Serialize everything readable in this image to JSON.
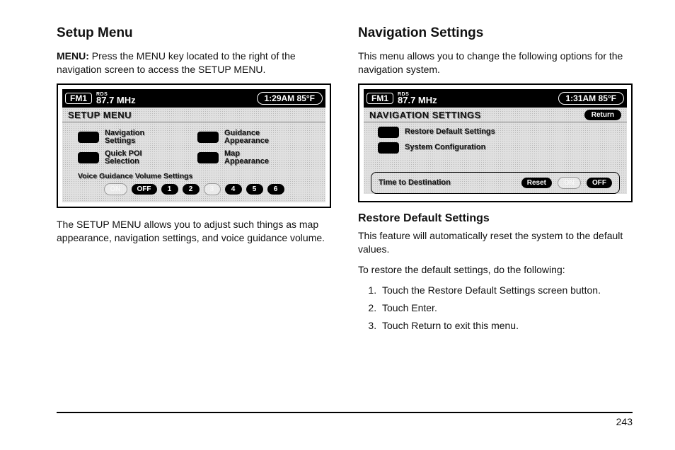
{
  "left": {
    "heading": "Setup Menu",
    "intro_label": "MENU:",
    "intro_text": "  Press the MENU key located to the right of the navigation screen to access the SETUP MENU.",
    "after_text": "The SETUP MENU allows you to adjust such things as map appearance, navigation settings, and voice guidance volume.",
    "screen": {
      "band": "FM1",
      "rds": "RDS",
      "freq": "87.7 MHz",
      "clock": "1:29AM 85°F",
      "title": "SETUP MENU",
      "items": [
        {
          "label": "Navigation\nSettings"
        },
        {
          "label": "Guidance\nAppearance"
        },
        {
          "label": "Quick POI\nSelection"
        },
        {
          "label": "Map\nAppearance"
        }
      ],
      "vol_caption": "Voice Guidance Volume Settings",
      "vol_buttons": [
        "ON",
        "OFF",
        "1",
        "2",
        "3",
        "4",
        "5",
        "6"
      ]
    }
  },
  "right": {
    "heading": "Navigation Settings",
    "intro_text": "This menu allows you to change the following options for the navigation system.",
    "screen": {
      "band": "FM1",
      "rds": "RDS",
      "freq": "87.7 MHz",
      "clock": "1:31AM 85°F",
      "title": "NAVIGATION SETTINGS",
      "return": "Return",
      "items": [
        {
          "label": "Restore Default Settings"
        },
        {
          "label": "System Configuration"
        }
      ],
      "ttd_label": "Time to Destination",
      "ttd_buttons": [
        "Reset",
        "ON",
        "OFF"
      ]
    },
    "sub_heading": "Restore Default Settings",
    "sub_p1": "This feature will automatically reset the system to the default values.",
    "sub_p2": "To restore the default settings, do the following:",
    "steps": [
      "Touch the Restore Default Settings screen button.",
      "Touch Enter.",
      "Touch Return to exit this menu."
    ]
  },
  "page_number": "243"
}
